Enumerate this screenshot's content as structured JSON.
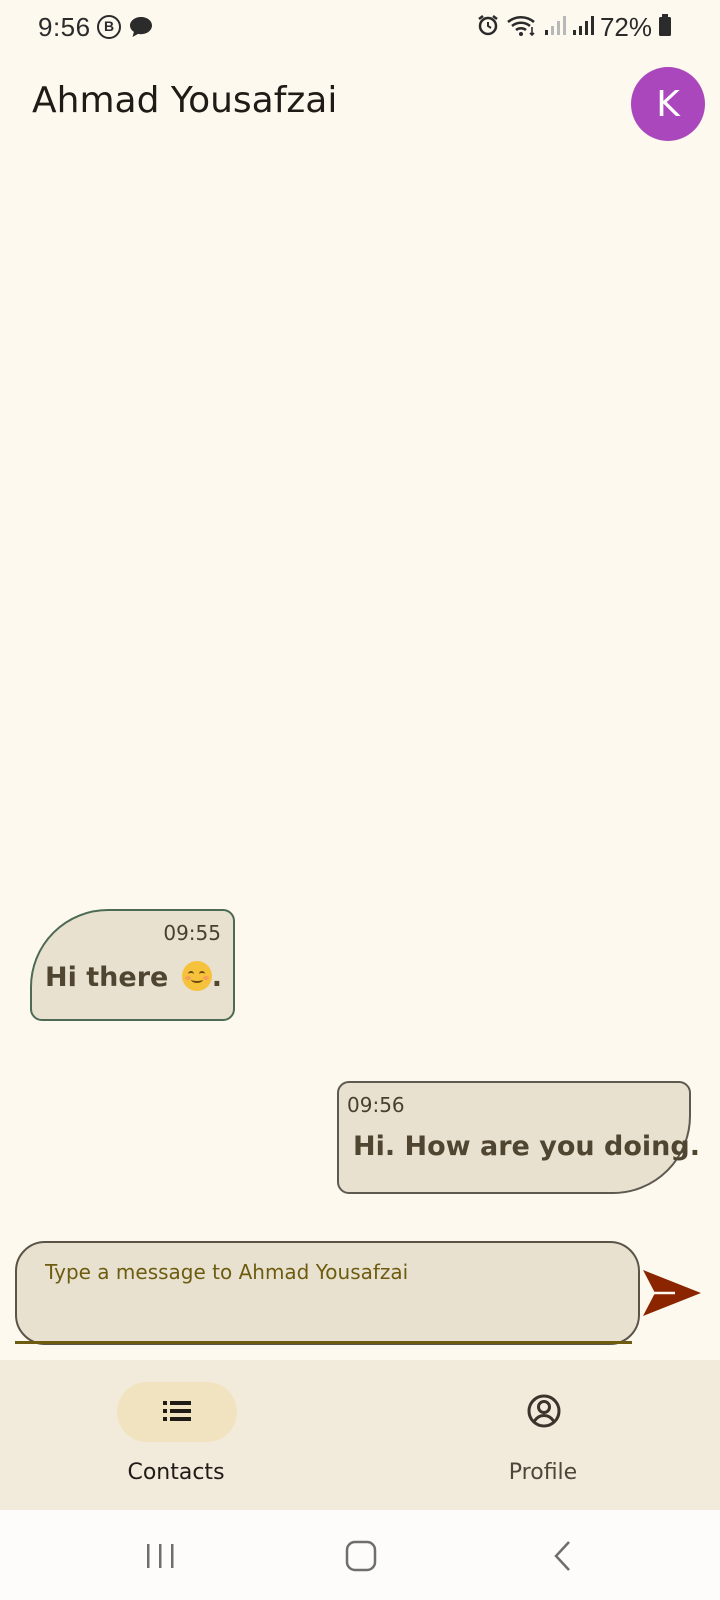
{
  "status_bar": {
    "time": "9:56",
    "b_icon_letter": "B",
    "battery": "72%"
  },
  "header": {
    "contact_name": "Ahmad Yousafzai",
    "avatar_letter": "K",
    "avatar_color": "#ab47bc"
  },
  "messages": [
    {
      "direction": "incoming",
      "time": "09:55",
      "text": "Hi there",
      "trailing": ".",
      "emoji": "smiling-face"
    },
    {
      "direction": "outgoing",
      "time": "09:56",
      "text": "Hi. How are you doing."
    }
  ],
  "composer": {
    "placeholder": "Type a message to Ahmad Yousafzai",
    "value": "",
    "send_icon": "send-icon",
    "send_color": "#8b2500"
  },
  "bottom_nav": {
    "items": [
      {
        "label": "Contacts",
        "icon": "list-icon",
        "selected": true
      },
      {
        "label": "Profile",
        "icon": "account-circle-icon",
        "selected": false
      }
    ]
  },
  "system_nav": {
    "items": [
      "recents-icon",
      "home-icon",
      "back-icon"
    ]
  },
  "colors": {
    "background": "#fdf9ee",
    "bubble": "#e8e1cf",
    "accent": "#6d5c10"
  }
}
